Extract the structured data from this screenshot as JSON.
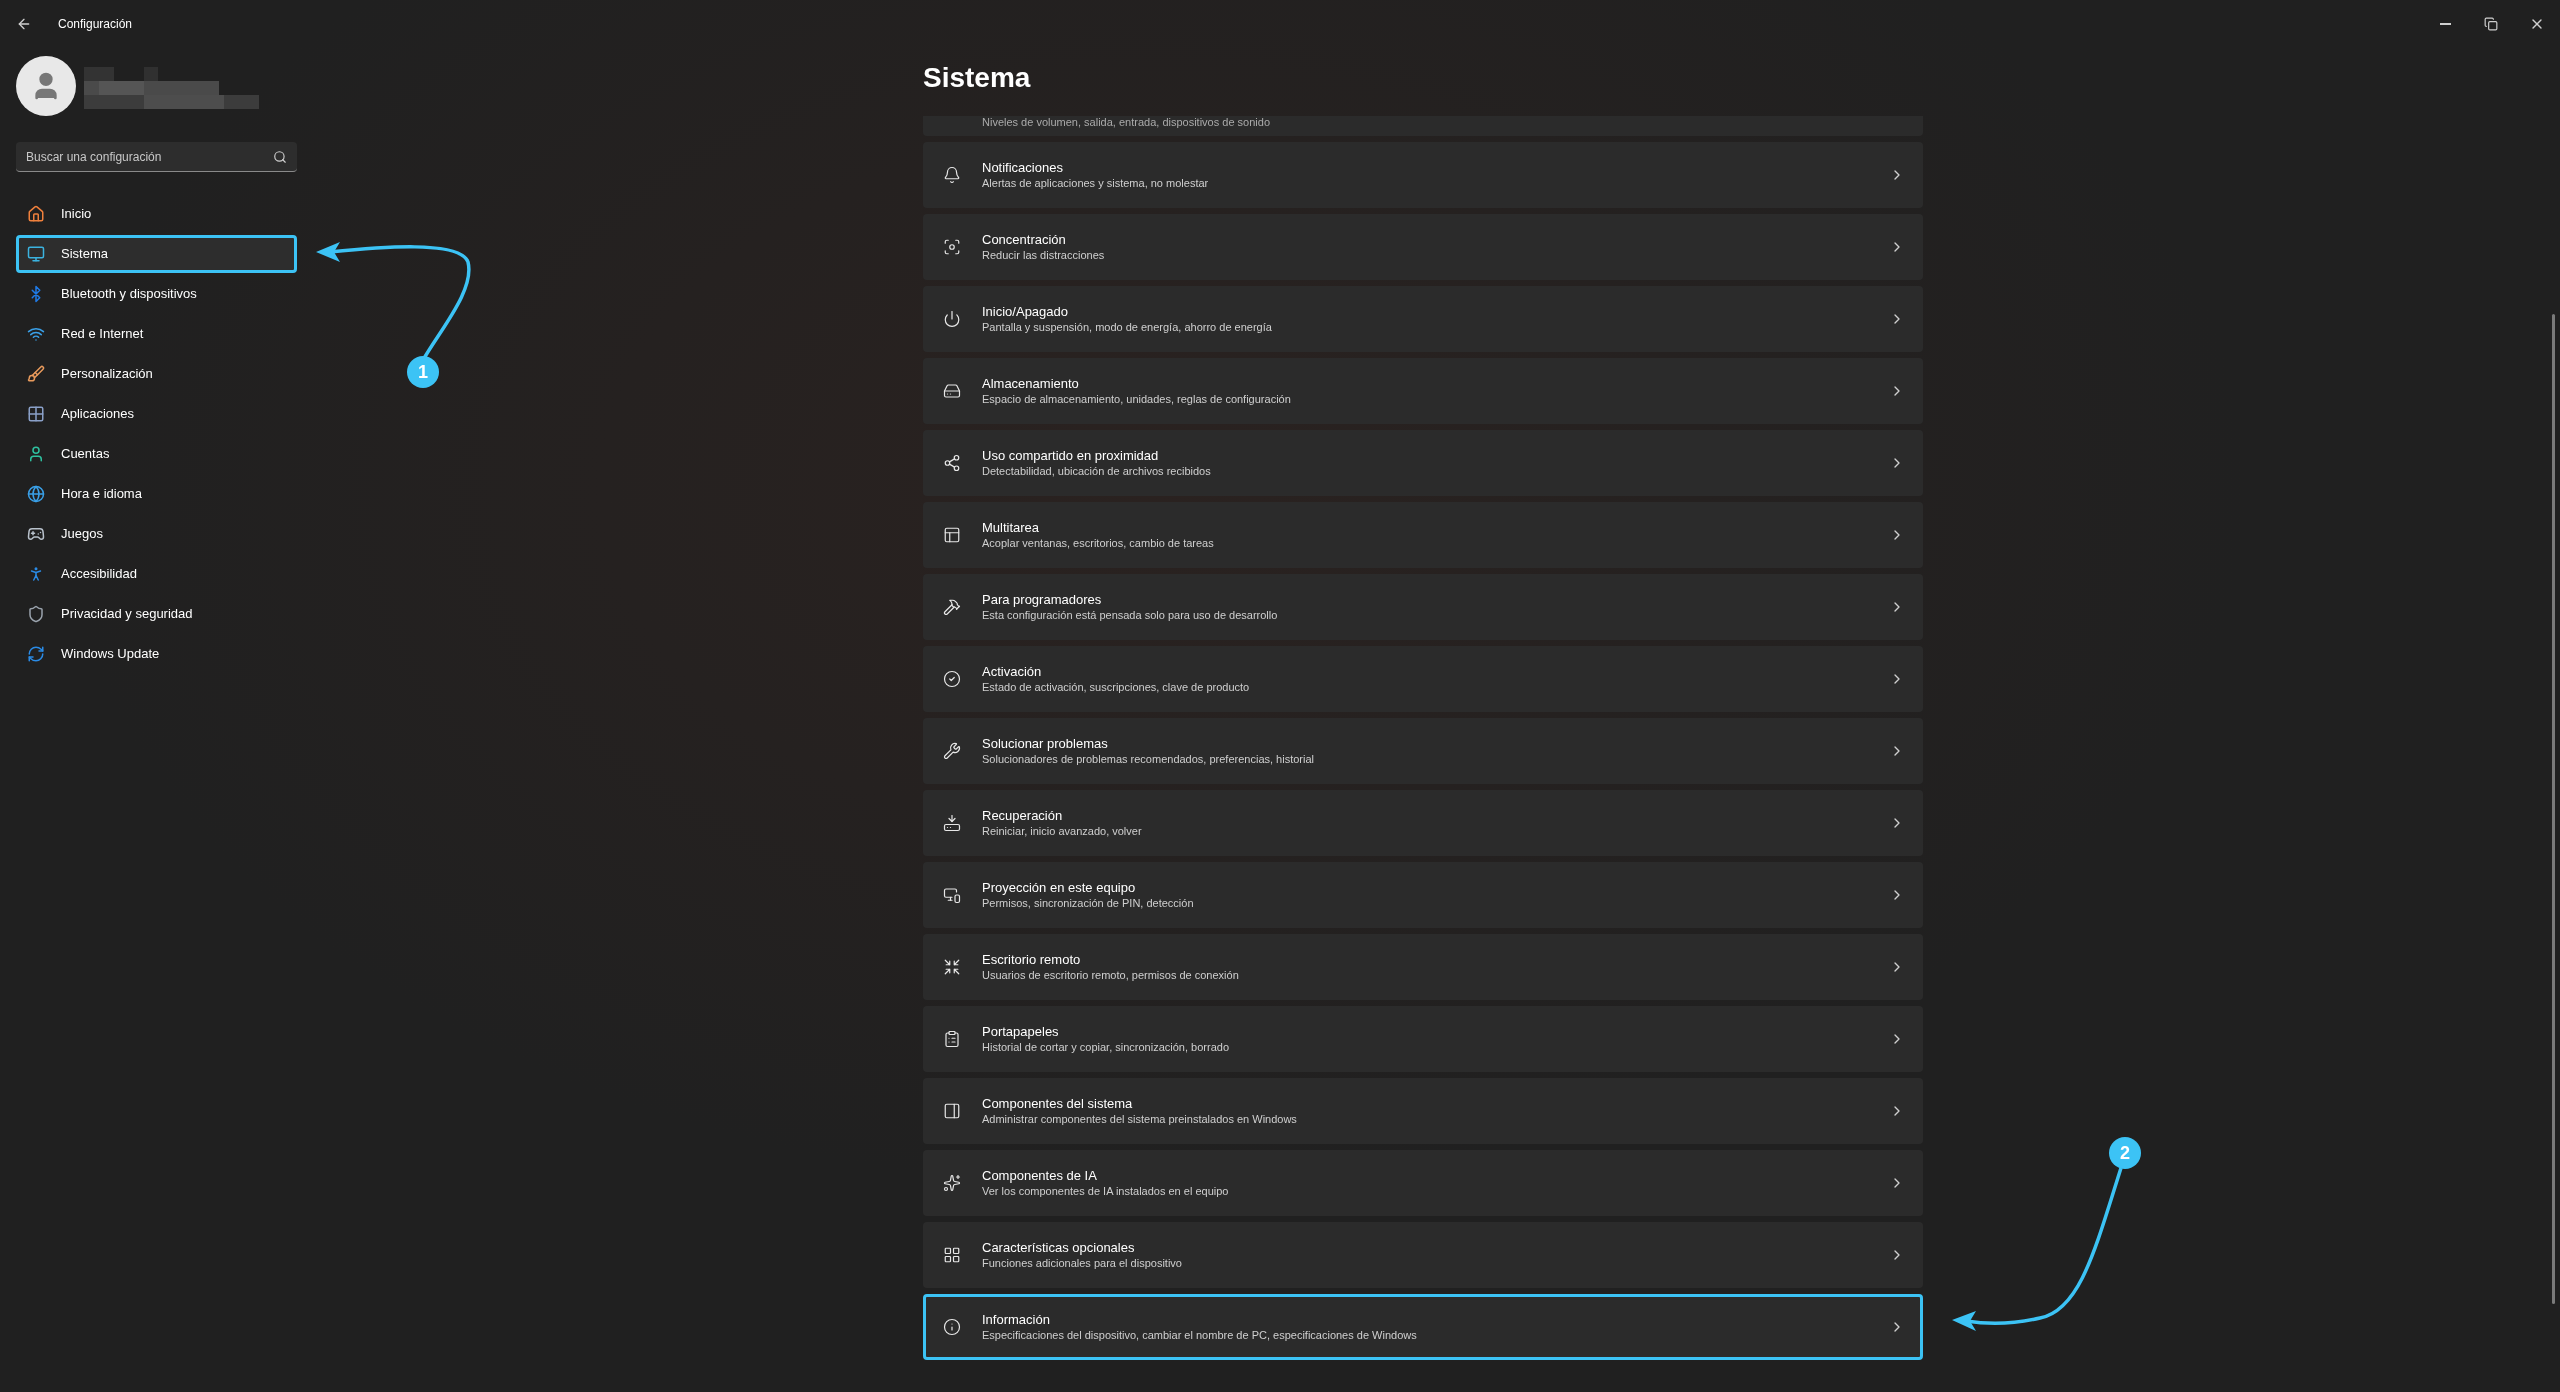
{
  "window": {
    "title": "Configuración"
  },
  "user": {
    "kind": "redacted"
  },
  "search": {
    "placeholder": "Buscar una configuración"
  },
  "nav": [
    {
      "label": "Inicio",
      "selected": false,
      "highlighted": false
    },
    {
      "label": "Sistema",
      "selected": true,
      "highlighted": true
    },
    {
      "label": "Bluetooth y dispositivos",
      "selected": false,
      "highlighted": false
    },
    {
      "label": "Red e Internet",
      "selected": false,
      "highlighted": false
    },
    {
      "label": "Personalización",
      "selected": false,
      "highlighted": false
    },
    {
      "label": "Aplicaciones",
      "selected": false,
      "highlighted": false
    },
    {
      "label": "Cuentas",
      "selected": false,
      "highlighted": false
    },
    {
      "label": "Hora e idioma",
      "selected": false,
      "highlighted": false
    },
    {
      "label": "Juegos",
      "selected": false,
      "highlighted": false
    },
    {
      "label": "Accesibilidad",
      "selected": false,
      "highlighted": false
    },
    {
      "label": "Privacidad y seguridad",
      "selected": false,
      "highlighted": false
    },
    {
      "label": "Windows Update",
      "selected": false,
      "highlighted": false
    }
  ],
  "page": {
    "title": "Sistema"
  },
  "partial_card": {
    "subtitle": "Niveles de volumen, salida, entrada, dispositivos de sonido"
  },
  "cards": [
    {
      "title": "Notificaciones",
      "subtitle": "Alertas de aplicaciones y sistema, no molestar",
      "highlighted": false
    },
    {
      "title": "Concentración",
      "subtitle": "Reducir las distracciones",
      "highlighted": false
    },
    {
      "title": "Inicio/Apagado",
      "subtitle": "Pantalla y suspensión, modo de energía, ahorro de energía",
      "highlighted": false
    },
    {
      "title": "Almacenamiento",
      "subtitle": "Espacio de almacenamiento, unidades, reglas de configuración",
      "highlighted": false
    },
    {
      "title": "Uso compartido en proximidad",
      "subtitle": "Detectabilidad, ubicación de archivos recibidos",
      "highlighted": false
    },
    {
      "title": "Multitarea",
      "subtitle": "Acoplar ventanas, escritorios, cambio de tareas",
      "highlighted": false
    },
    {
      "title": "Para programadores",
      "subtitle": "Esta configuración está pensada solo para uso de desarrollo",
      "highlighted": false
    },
    {
      "title": "Activación",
      "subtitle": "Estado de activación, suscripciones, clave de producto",
      "highlighted": false
    },
    {
      "title": "Solucionar problemas",
      "subtitle": "Solucionadores de problemas recomendados, preferencias, historial",
      "highlighted": false
    },
    {
      "title": "Recuperación",
      "subtitle": "Reiniciar, inicio avanzado, volver",
      "highlighted": false
    },
    {
      "title": "Proyección en este equipo",
      "subtitle": "Permisos, sincronización de PIN, detección",
      "highlighted": false
    },
    {
      "title": "Escritorio remoto",
      "subtitle": "Usuarios de escritorio remoto, permisos de conexión",
      "highlighted": false
    },
    {
      "title": "Portapapeles",
      "subtitle": "Historial de cortar y copiar, sincronización, borrado",
      "highlighted": false
    },
    {
      "title": "Componentes del sistema",
      "subtitle": "Administrar componentes del sistema preinstalados en Windows",
      "highlighted": false
    },
    {
      "title": "Componentes de IA",
      "subtitle": "Ver los componentes de IA instalados en el equipo",
      "highlighted": false
    },
    {
      "title": "Características opcionales",
      "subtitle": "Funciones adicionales para el dispositivo",
      "highlighted": false
    },
    {
      "title": "Información",
      "subtitle": "Especificaciones del dispositivo, cambiar el nombre de PC, especificaciones de Windows",
      "highlighted": true
    }
  ],
  "callouts": [
    {
      "label": "1"
    },
    {
      "label": "2"
    }
  ]
}
